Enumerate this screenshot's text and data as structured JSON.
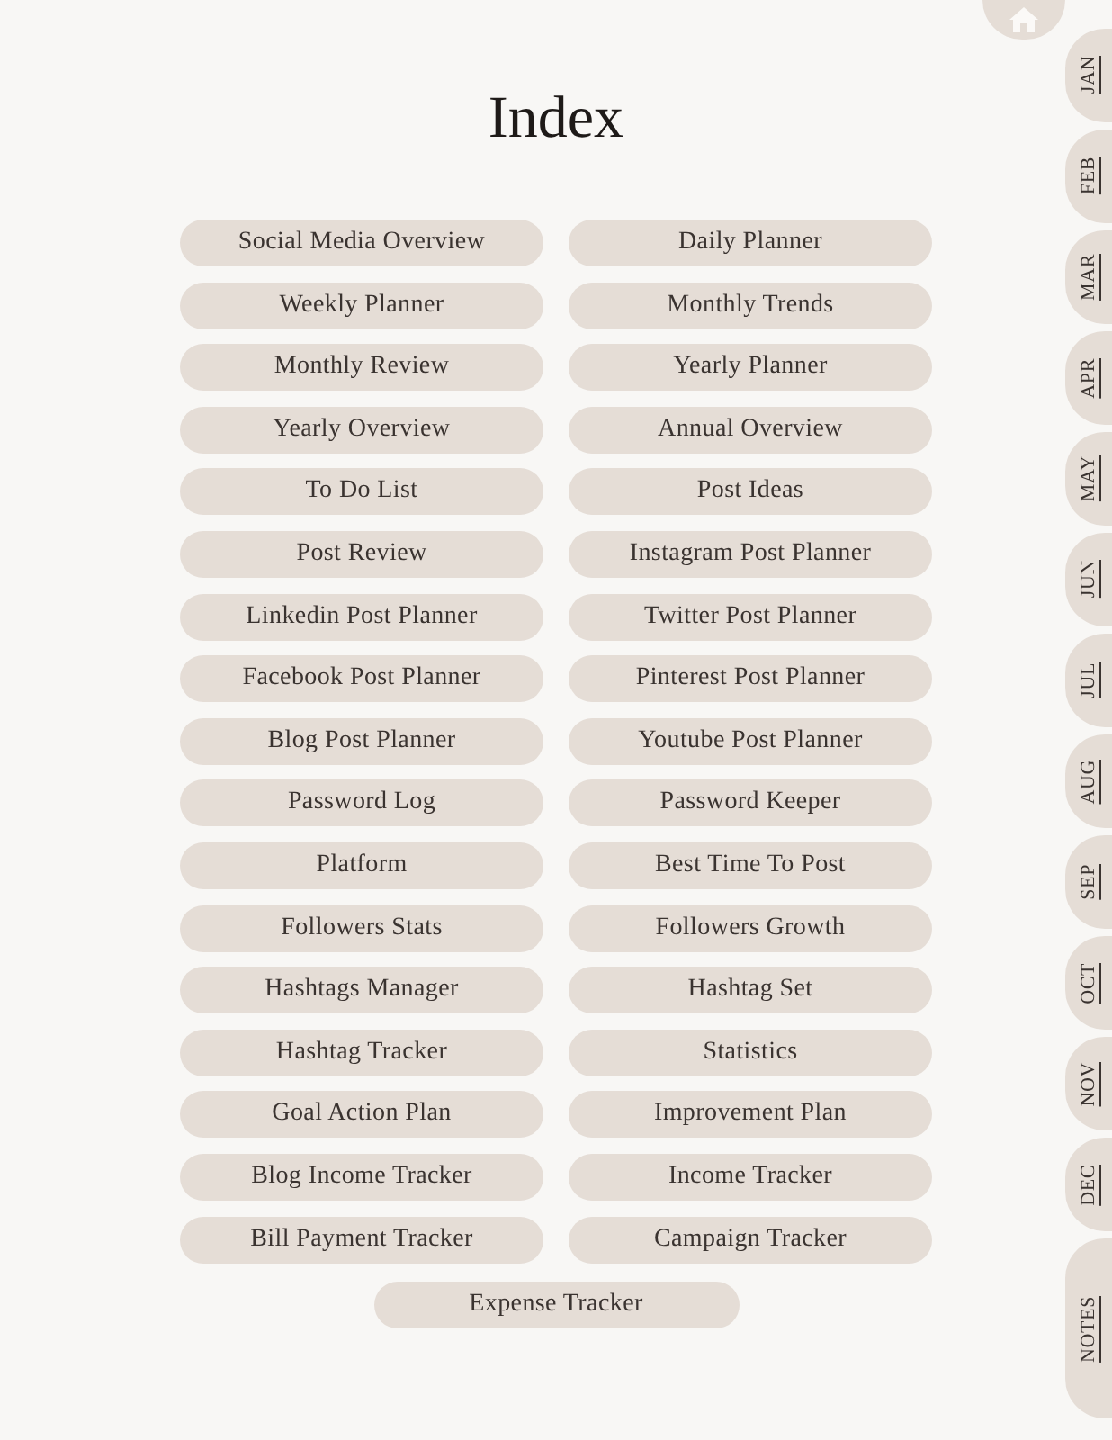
{
  "title": "Index",
  "links": [
    "Social Media Overview",
    "Daily Planner",
    "Weekly Planner",
    "Monthly Trends",
    "Monthly Review",
    "Yearly Planner",
    "Yearly Overview",
    "Annual Overview",
    "To Do List",
    "Post Ideas",
    "Post Review",
    "Instagram Post Planner",
    "Linkedin Post Planner",
    "Twitter Post Planner",
    "Facebook Post Planner",
    "Pinterest Post Planner",
    "Blog Post Planner",
    "Youtube Post Planner",
    "Password Log",
    "Password Keeper",
    "Platform",
    "Best Time To Post",
    "Followers Stats",
    "Followers Growth",
    "Hashtags Manager",
    "Hashtag Set",
    "Hashtag Tracker",
    "Statistics",
    "Goal Action Plan",
    "Improvement Plan",
    "Blog Income Tracker",
    "Income Tracker",
    "Bill Payment Tracker",
    "Campaign Tracker"
  ],
  "last_link": "Expense Tracker",
  "side_tabs": [
    {
      "label": "JAN",
      "kind": "month"
    },
    {
      "label": "FEB",
      "kind": "month"
    },
    {
      "label": "MAR",
      "kind": "month"
    },
    {
      "label": "APR",
      "kind": "month"
    },
    {
      "label": "MAY",
      "kind": "month"
    },
    {
      "label": "JUN",
      "kind": "month"
    },
    {
      "label": "JUL",
      "kind": "month"
    },
    {
      "label": "AUG",
      "kind": "month"
    },
    {
      "label": "SEP",
      "kind": "month"
    },
    {
      "label": "OCT",
      "kind": "month"
    },
    {
      "label": "NOV",
      "kind": "month"
    },
    {
      "label": "DEC",
      "kind": "month"
    },
    {
      "label": "NOTES",
      "kind": "notes"
    }
  ]
}
